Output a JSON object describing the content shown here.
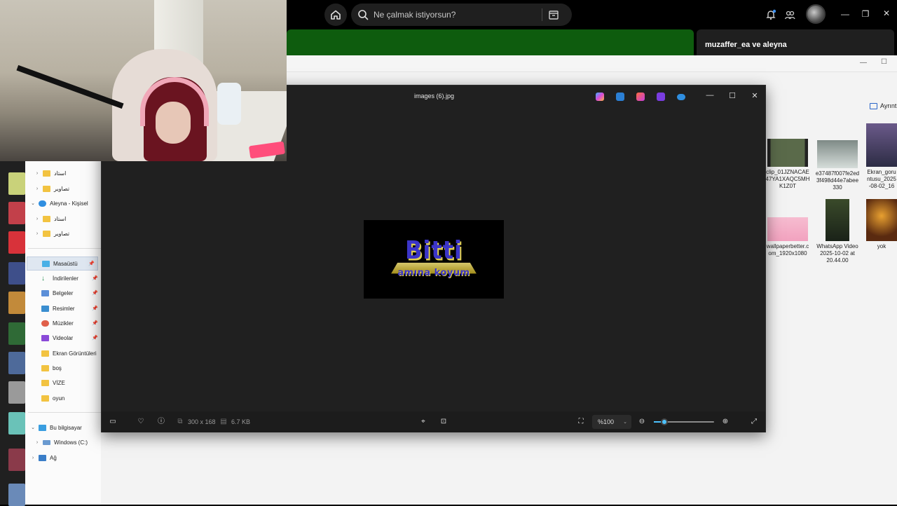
{
  "spotify": {
    "search_placeholder": "Ne çalmak istiyorsun?",
    "panel_title": "muzaffer_ea ve aleyna"
  },
  "explorer": {
    "details_label": "Ayrıntı",
    "thumbnails": [
      {
        "name": "clip_01JZNACAE47YA1XAQC5MHK1Z0T"
      },
      {
        "name": "e37487f007fe2ed3f498d44e7abee330"
      },
      {
        "name": "Ekran_goruntusu_2025-08-02_16"
      },
      {
        "name": "wallpaperbetter.com_1920x1080"
      },
      {
        "name": "WhatsApp Video 2025-10-02 at 20.44.00"
      },
      {
        "name": "yok"
      }
    ],
    "sidebar": [
      {
        "label": "استاد",
        "chev": "›"
      },
      {
        "label": "تصاوير",
        "chev": "›"
      },
      {
        "label": "Aleyna - Kişisel",
        "chev": "⌄"
      },
      {
        "label": "استاد",
        "chev": "›"
      },
      {
        "label": "تصاوير",
        "chev": "›"
      },
      {
        "label": "Masaüstü",
        "pinned": true
      },
      {
        "label": "İndirilenler",
        "pinned": true
      },
      {
        "label": "Belgeler",
        "pinned": true
      },
      {
        "label": "Resimler",
        "pinned": true
      },
      {
        "label": "Müzikler",
        "pinned": true
      },
      {
        "label": "Videolar",
        "pinned": true
      },
      {
        "label": "Ekran Görüntüleri"
      },
      {
        "label": "boş"
      },
      {
        "label": "VİZE"
      },
      {
        "label": "oyun"
      },
      {
        "label": "Bu bilgisayar",
        "chev": "⌄"
      },
      {
        "label": "Windows (C:)",
        "chev": "›"
      },
      {
        "label": "Ağ",
        "chev": "›"
      }
    ]
  },
  "viewer": {
    "title": "images (6).jpg",
    "dimensions": "300 x 168",
    "file_size": "6.7 KB",
    "zoom": "%100",
    "zoom_level": 0.18,
    "image_text_main": "Bitti",
    "image_text_sub": "amına koyum"
  },
  "colors": {
    "spotify_green": "#0e5c0e",
    "accent": "#4cc2ff"
  }
}
